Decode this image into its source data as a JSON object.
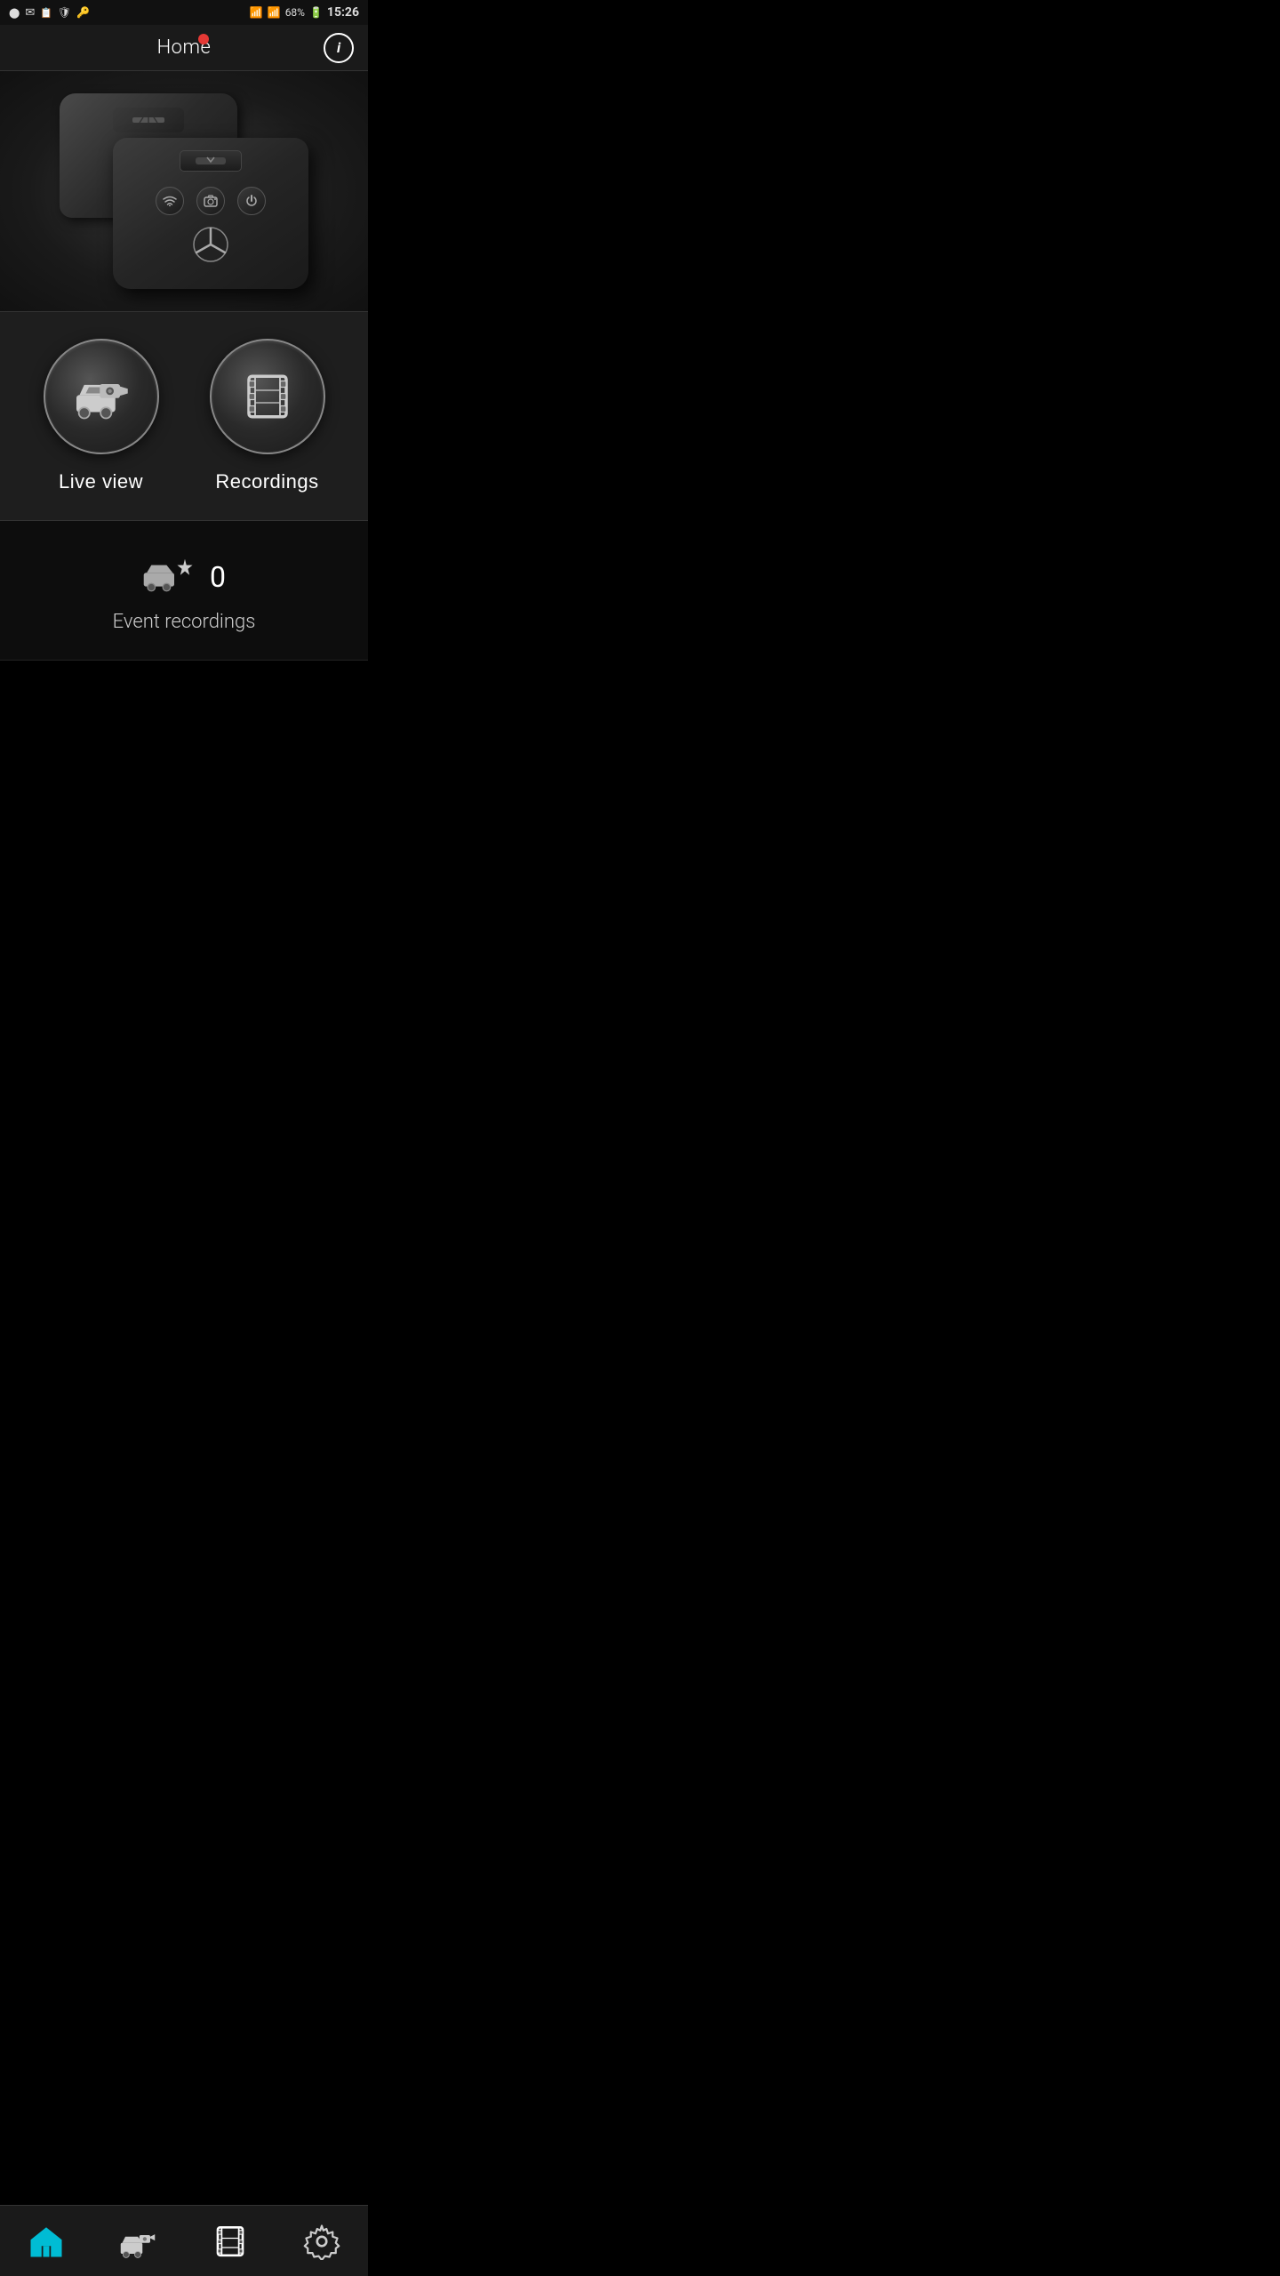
{
  "status_bar": {
    "time": "15:26",
    "battery": "68%",
    "wifi": true,
    "signal": true
  },
  "header": {
    "title": "Home",
    "info_label": "i",
    "recording_dot": true
  },
  "buttons": {
    "live_view_label": "Live view",
    "recordings_label": "Recordings"
  },
  "events": {
    "count": "0",
    "label": "Event recordings"
  },
  "nav": {
    "home": "Home",
    "camera": "Live view",
    "recordings": "Recordings",
    "settings": "Settings"
  }
}
